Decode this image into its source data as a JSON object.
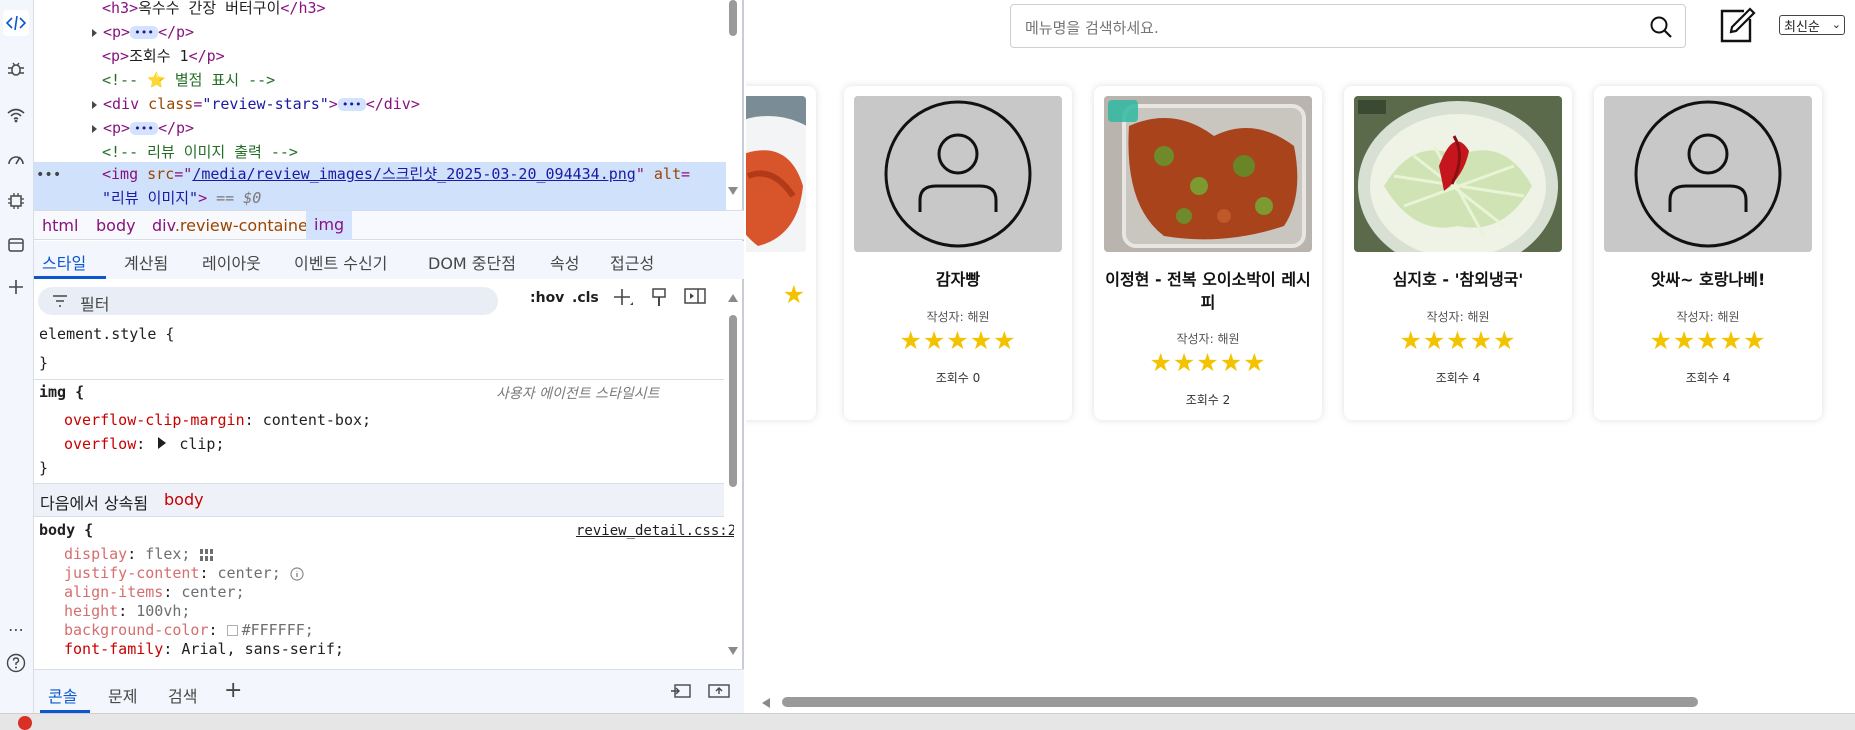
{
  "dom": {
    "line_h3_open": "<h3>",
    "line_h3_text": "옥수수 간장 버터구이",
    "line_h3_close": "</h3>",
    "p_open": "<p>",
    "p_close": "</p>",
    "views_text": "조회수 1",
    "comment_stars": "<!-- ⭐ 별점 표시 -->",
    "div_open": "<div",
    "div_attr": "class",
    "div_val": "\"review-stars\"",
    "div_close": "</div>",
    "comment_img": "<!-- 리뷰 이미지 출력 -->",
    "img_open": "<img",
    "img_src_attr": "src",
    "img_src_val": "/media/review_images/스크린샷_2025-03-20_094434.png",
    "img_alt_attr": "alt",
    "img_alt_val": "\"리뷰 이미지\"",
    "img_dollar": "== $0",
    "ellipsis": "•••"
  },
  "breadcrumb": [
    "html",
    "body",
    "div",
    ".review-container",
    "img"
  ],
  "style_tabs": [
    "스타일",
    "계산됨",
    "레이아웃",
    "이벤트 수신기",
    "DOM 중단점",
    "속성",
    "접근성"
  ],
  "filter": {
    "placeholder": "필터",
    "hov": ":hov",
    "cls": ".cls"
  },
  "styles": {
    "element_style": "element.style {",
    "close_brace": "}",
    "img_selector": "img {",
    "ua_label": "사용자 에이전트 스타일시트",
    "img_props": [
      {
        "name": "overflow-clip-margin",
        "value": "content-box;"
      },
      {
        "name": "overflow",
        "value": "clip;"
      }
    ],
    "inherited_label": "다음에서 상속됨",
    "inherited_from": "body",
    "body_selector": "body {",
    "body_source": "review_detail.css:2",
    "body_props": [
      {
        "name": "display",
        "value": "flex;"
      },
      {
        "name": "justify-content",
        "value": "center;"
      },
      {
        "name": "align-items",
        "value": "center;"
      },
      {
        "name": "height",
        "value": "100vh;"
      },
      {
        "name": "background-color",
        "value": "#FFFFFF;"
      },
      {
        "name": "font-family",
        "value": "Arial, sans-serif;"
      }
    ]
  },
  "console_tabs": [
    "콘솔",
    "문제",
    "검색"
  ],
  "page": {
    "search_placeholder": "메뉴명을 검색하세요.",
    "sort_selected": "최신순",
    "cards": [
      {
        "title": "감자빵",
        "author": "작성자: 해원",
        "stars": "★★★★★",
        "views": "조회수 0",
        "image": "placeholder"
      },
      {
        "title": "이정현 - 전복 오이소박이 레시피",
        "author": "작성자: 해원",
        "stars": "★★★★★",
        "views": "조회수 2",
        "image": "kimchi-photo"
      },
      {
        "title": "심지호 - '참외냉국'",
        "author": "작성자: 해원",
        "stars": "★★★★★",
        "views": "조회수 4",
        "image": "cold-soup-photo"
      },
      {
        "title": "앗싸~ 호랑나베!",
        "author": "작성자: 해원",
        "stars": "★★★★★",
        "views": "조회수 4",
        "image": "placeholder"
      }
    ],
    "partial_card_stars": "★"
  },
  "colors": {
    "accent": "#0b57d0",
    "star": "#f3c300",
    "tag": "#881280",
    "attr": "#994500",
    "attr_value": "#1a1aa6"
  }
}
